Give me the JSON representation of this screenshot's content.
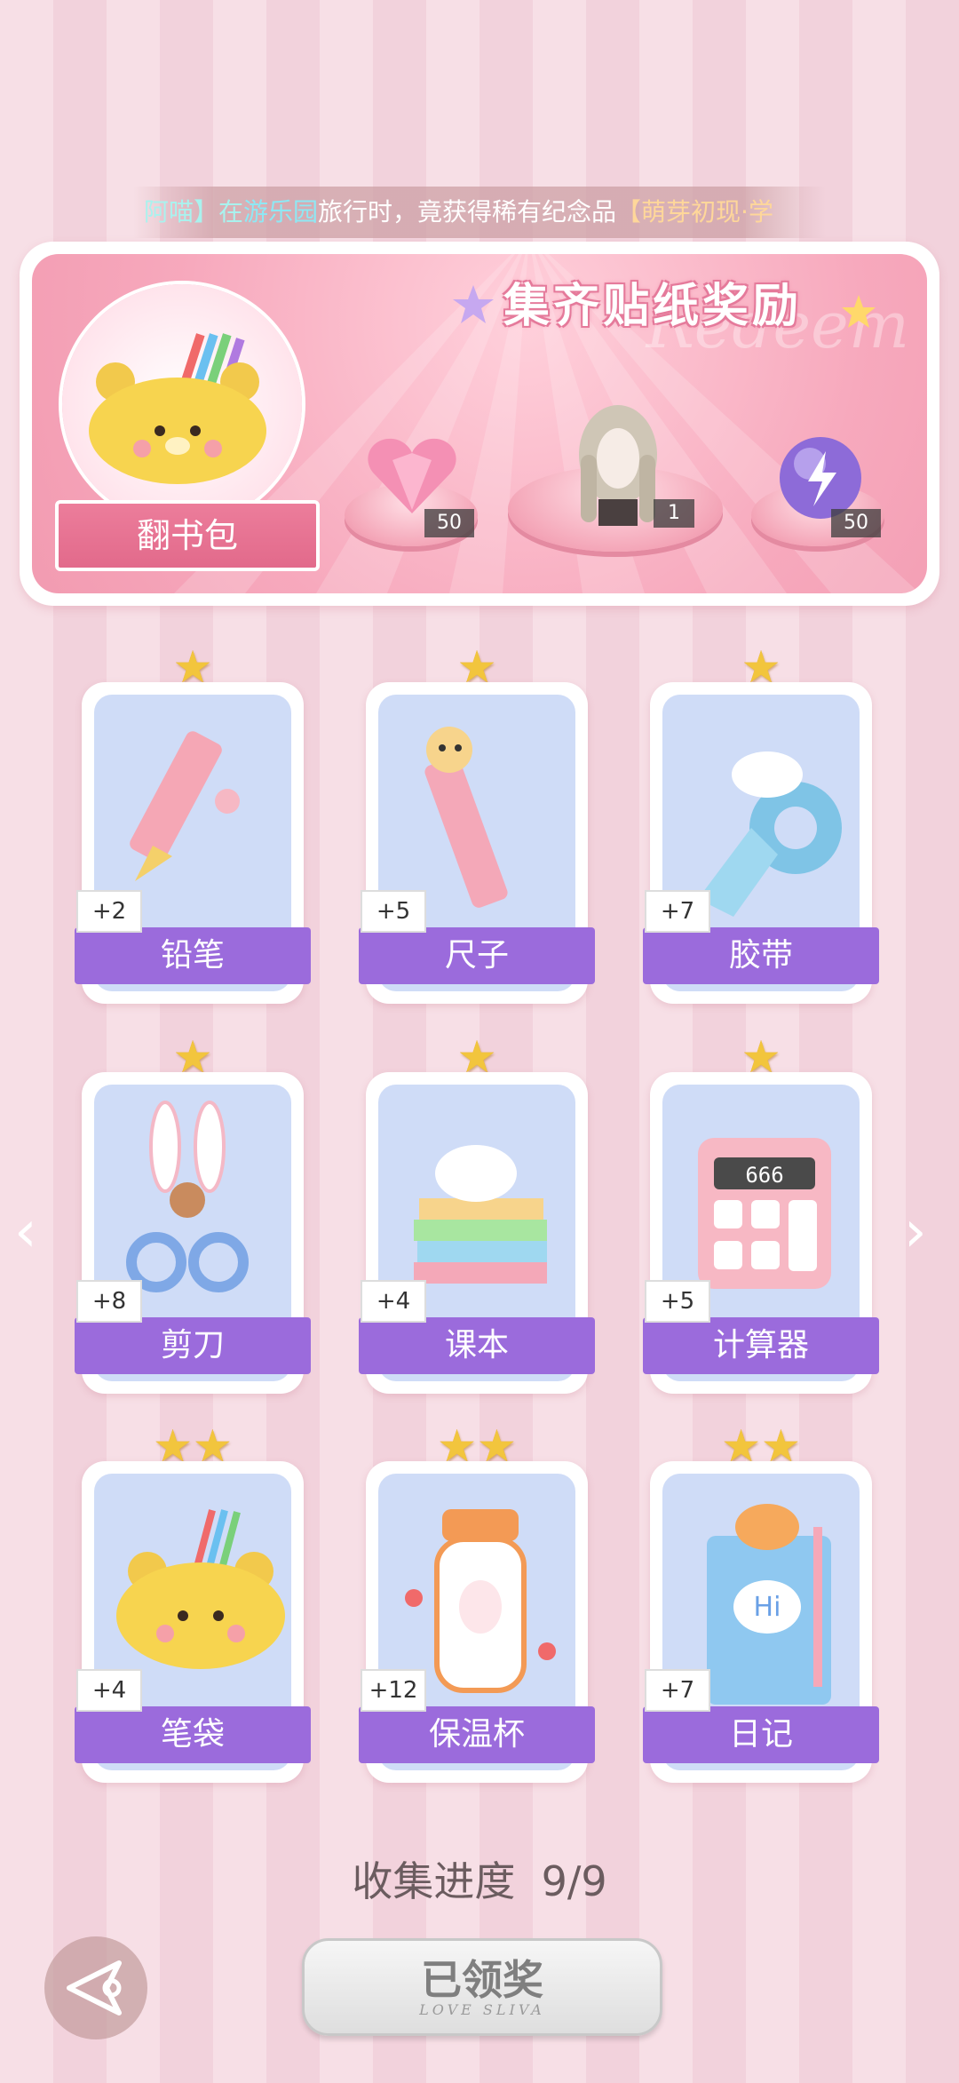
{
  "marquee": {
    "part1": "阿喵】在",
    "part2": "游乐园",
    "part3": "旅行时，竟获得稀有纪念品",
    "part4": "【萌芽初现·学"
  },
  "reward": {
    "title": "集齐贴纸奖励",
    "watermark": "Redeem",
    "bag_label": "翻书包",
    "items": [
      {
        "name": "heart-gem",
        "count": "50"
      },
      {
        "name": "hairstyle",
        "count": "1"
      },
      {
        "name": "energy-orb",
        "count": "50"
      }
    ]
  },
  "stickers": [
    {
      "label": "铅笔",
      "bonus": "+2",
      "stars": 1,
      "icon": "pencil-icon"
    },
    {
      "label": "尺子",
      "bonus": "+5",
      "stars": 1,
      "icon": "ruler-icon"
    },
    {
      "label": "胶带",
      "bonus": "+7",
      "stars": 1,
      "icon": "tape-icon"
    },
    {
      "label": "剪刀",
      "bonus": "+8",
      "stars": 1,
      "icon": "scissors-icon"
    },
    {
      "label": "课本",
      "bonus": "+4",
      "stars": 1,
      "icon": "textbook-icon"
    },
    {
      "label": "计算器",
      "bonus": "+5",
      "stars": 1,
      "icon": "calculator-icon"
    },
    {
      "label": "笔袋",
      "bonus": "+4",
      "stars": 2,
      "icon": "pencil-case-icon"
    },
    {
      "label": "保温杯",
      "bonus": "+12",
      "stars": 2,
      "icon": "thermos-icon"
    },
    {
      "label": "日记",
      "bonus": "+7",
      "stars": 2,
      "icon": "diary-icon"
    }
  ],
  "calculator_display": "666",
  "diary_text": "Hi",
  "progress": {
    "label": "收集进度",
    "value": "9/9"
  },
  "claim_button": {
    "label": "已领奖",
    "subtitle": "LOVE SLIVA"
  },
  "colors": {
    "card_bar": "#9b6bdc",
    "panel": "#f7a9bd",
    "star": "#f2c53d"
  }
}
